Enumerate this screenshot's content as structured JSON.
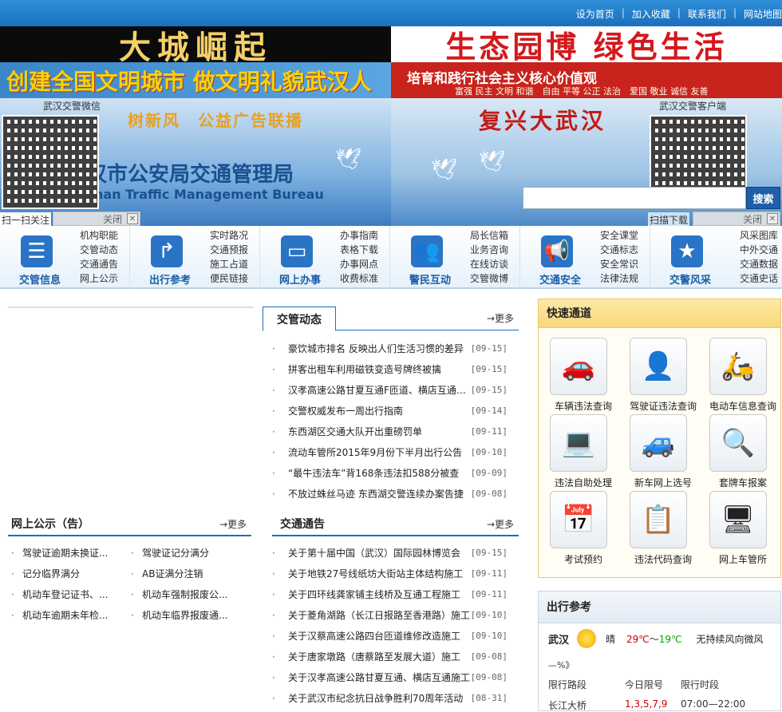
{
  "header": {
    "links": [
      "设为首页",
      "加入收藏",
      "联系我们",
      "网站地图"
    ]
  },
  "banners": {
    "slogan1": "大城崛起",
    "slogan2": "生态园博 绿色生活",
    "slogan3": "创建全国文明城市 做文明礼貌武汉人",
    "slogan4_line1": "培育和践行社会主义核心价值观",
    "slogan4_line2": "富强 民主 文明 和谐　自由 平等 公正 法治　爱国 敬业 诚信 友善",
    "slogan5": "树新风　公益广告联播",
    "slogan6": "复兴大武汉",
    "site_title": "汉市公安局交通管理局",
    "site_subtitle": "han Traffic Management Bureau"
  },
  "qr": {
    "left_label": "武汉交警微信",
    "right_label": "武汉交警客户端",
    "left_scan": "扫一扫关注",
    "right_scan": "扫描下载",
    "close": "关闭"
  },
  "search": {
    "button": "搜索"
  },
  "nav": [
    {
      "title": "交管信息",
      "icon": "document-list-icon",
      "color": "#2a74c6",
      "subs": [
        "机构职能",
        "交管动态",
        "交通通告",
        "网上公示"
      ]
    },
    {
      "title": "出行参考",
      "icon": "road-sign-icon",
      "color": "#2a74c6",
      "subs": [
        "实时路况",
        "交通预报",
        "施工占道",
        "便民链接"
      ]
    },
    {
      "title": "网上办事",
      "icon": "monitor-icon",
      "color": "#2a74c6",
      "subs": [
        "办事指南",
        "表格下载",
        "办事网点",
        "收费标准"
      ]
    },
    {
      "title": "警民互动",
      "icon": "people-icon",
      "color": "#2a74c6",
      "subs": [
        "局长信箱",
        "业务咨询",
        "在线访谈",
        "交管微博"
      ]
    },
    {
      "title": "交通安全",
      "icon": "megaphone-icon",
      "color": "#2a74c6",
      "subs": [
        "安全课堂",
        "交通标志",
        "安全常识",
        "法律法规"
      ]
    },
    {
      "title": "交警风采",
      "icon": "star-icon",
      "color": "#2a74c6",
      "subs": [
        "风采图库",
        "中外交通",
        "交通数据",
        "交通史话"
      ]
    }
  ],
  "dynamics": {
    "title": "交管动态",
    "more": "→更多",
    "items": [
      {
        "t": "豪饮城市排名 反映出人们生活习惯的差异",
        "d": "[09-15]"
      },
      {
        "t": "拼客出租车利用磁铁变造号牌终被擒",
        "d": "[09-15]"
      },
      {
        "t": "汉孝高速公路甘夏互通F匝道、横店互通施工",
        "d": "[09-15]"
      },
      {
        "t": "交警权威发布一周出行指南",
        "d": "[09-14]"
      },
      {
        "t": "东西湖区交通大队开出重磅罚单",
        "d": "[09-11]"
      },
      {
        "t": "流动车管所2015年9月份下半月出行公告",
        "d": "[09-10]"
      },
      {
        "t": "“最牛违法车”背168条违法扣588分被查",
        "d": "[09-09]"
      },
      {
        "t": "不放过蛛丝马迹 东西湖交警连续办案告捷",
        "d": "[09-08]"
      }
    ]
  },
  "publicity": {
    "title": "网上公示（告）",
    "more": "→更多",
    "items": [
      "驾驶证逾期未换证...",
      "驾驶证记分满分",
      "记分临界满分",
      "AB证满分注销",
      "机动车登记证书、...",
      "机动车强制报废公...",
      "机动车逾期未年检...",
      "机动车临界报废通..."
    ]
  },
  "notices": {
    "title": "交通通告",
    "more": "→更多",
    "items": [
      {
        "t": "关于第十届中国（武汉）国际园林博览会",
        "d": "[09-15]"
      },
      {
        "t": "关于地铁27号线纸坊大街站主体结构施工",
        "d": "[09-11]"
      },
      {
        "t": "关于四环线龚家铺主线桥及互通工程施工",
        "d": "[09-11]"
      },
      {
        "t": "关于菱角湖路（长江日报路至香港路）施工",
        "d": "[09-10]"
      },
      {
        "t": "关于汉蔡高速公路四台匝道维修改造施工",
        "d": "[09-10]"
      },
      {
        "t": "关于唐家墩路（唐蔡路至发展大道）施工",
        "d": "[09-08]"
      },
      {
        "t": "关于汉孝高速公路甘夏互通、横店互通施工",
        "d": "[09-08]"
      },
      {
        "t": "关于武汉市纪念抗日战争胜利70周年活动",
        "d": "[08-31]"
      }
    ]
  },
  "quick": {
    "title": "快速通道",
    "items": [
      {
        "label": "车辆违法查询",
        "icon": "car-document-icon",
        "glyph": "🚗"
      },
      {
        "label": "驾驶证违法查询",
        "icon": "person-forbidden-icon",
        "glyph": "👤"
      },
      {
        "label": "电动车信息查询",
        "icon": "scooter-icon",
        "glyph": "🛵"
      },
      {
        "label": "违法自助处理",
        "icon": "laptop-icon",
        "glyph": "💻"
      },
      {
        "label": "新车网上选号",
        "icon": "car-plate-icon",
        "glyph": "🚙"
      },
      {
        "label": "套牌车报案",
        "icon": "magnifier-car-icon",
        "glyph": "🔍"
      },
      {
        "label": "考试预约",
        "icon": "calendar-add-icon",
        "glyph": "📅"
      },
      {
        "label": "违法代码查询",
        "icon": "code-search-icon",
        "glyph": "📋"
      },
      {
        "label": "网上车管所",
        "icon": "computer-screen-icon",
        "glyph": "🖥"
      }
    ]
  },
  "travel": {
    "title": "出行参考",
    "city": "武汉",
    "weather": "晴",
    "temp_high": "29℃",
    "temp_sep": "～",
    "temp_low": "19℃",
    "wind": "无持续风向微风",
    "pct": "—%》",
    "headers": [
      "限行路段",
      "今日限号",
      "限行时段"
    ],
    "row": [
      "长江大桥",
      "1,3,5,7,9",
      "07:00—22:00"
    ]
  }
}
